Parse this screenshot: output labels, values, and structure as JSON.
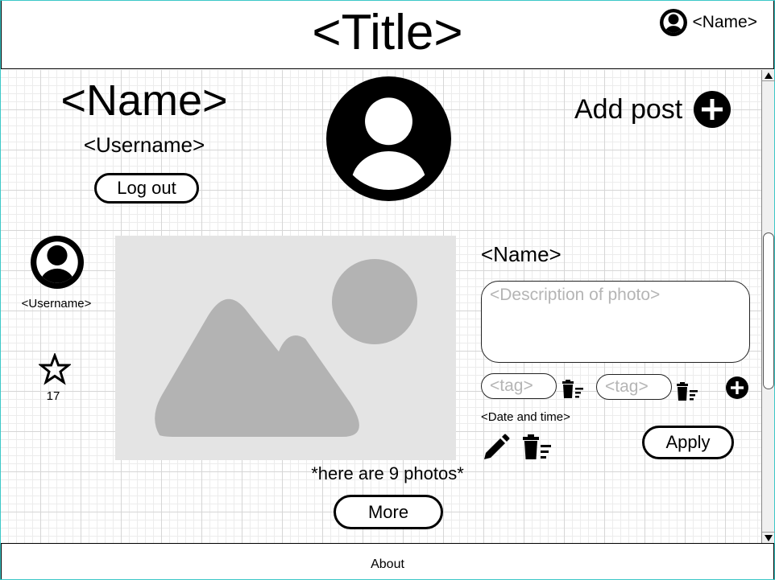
{
  "header": {
    "title": "<Title>",
    "user_name": "<Name>",
    "user_icon": "user-avatar-icon"
  },
  "profile": {
    "name": "<Name>",
    "username": "<Username>",
    "logout_label": "Log out",
    "avatar_icon": "user-avatar-icon",
    "add_post_label": "Add post",
    "add_post_icon": "plus-circle-icon"
  },
  "post": {
    "author_username": "<Username>",
    "author_icon": "user-avatar-icon",
    "star_icon": "star-outline-icon",
    "star_count": "17",
    "photo_icon": "image-placeholder-icon",
    "name": "<Name>",
    "description_placeholder": "<Description of photo>",
    "tags": [
      {
        "placeholder": "<tag>",
        "delete_icon": "trash-list-icon"
      },
      {
        "placeholder": "<tag>",
        "delete_icon": "trash-list-icon"
      }
    ],
    "add_tag_icon": "plus-circle-icon",
    "datetime": "<Date and time>",
    "edit_icon": "pencil-icon",
    "delete_icon": "trash-list-icon",
    "apply_label": "Apply"
  },
  "gallery": {
    "photo_count_text": "*here are 9 photos*",
    "more_label": "More"
  },
  "footer": {
    "about_label": "About"
  },
  "colors": {
    "frame": "#3cc8c8",
    "photo_bg": "#e4e4e4",
    "photo_shape": "#b3b3b3",
    "placeholder_text": "#b5b5b5"
  }
}
